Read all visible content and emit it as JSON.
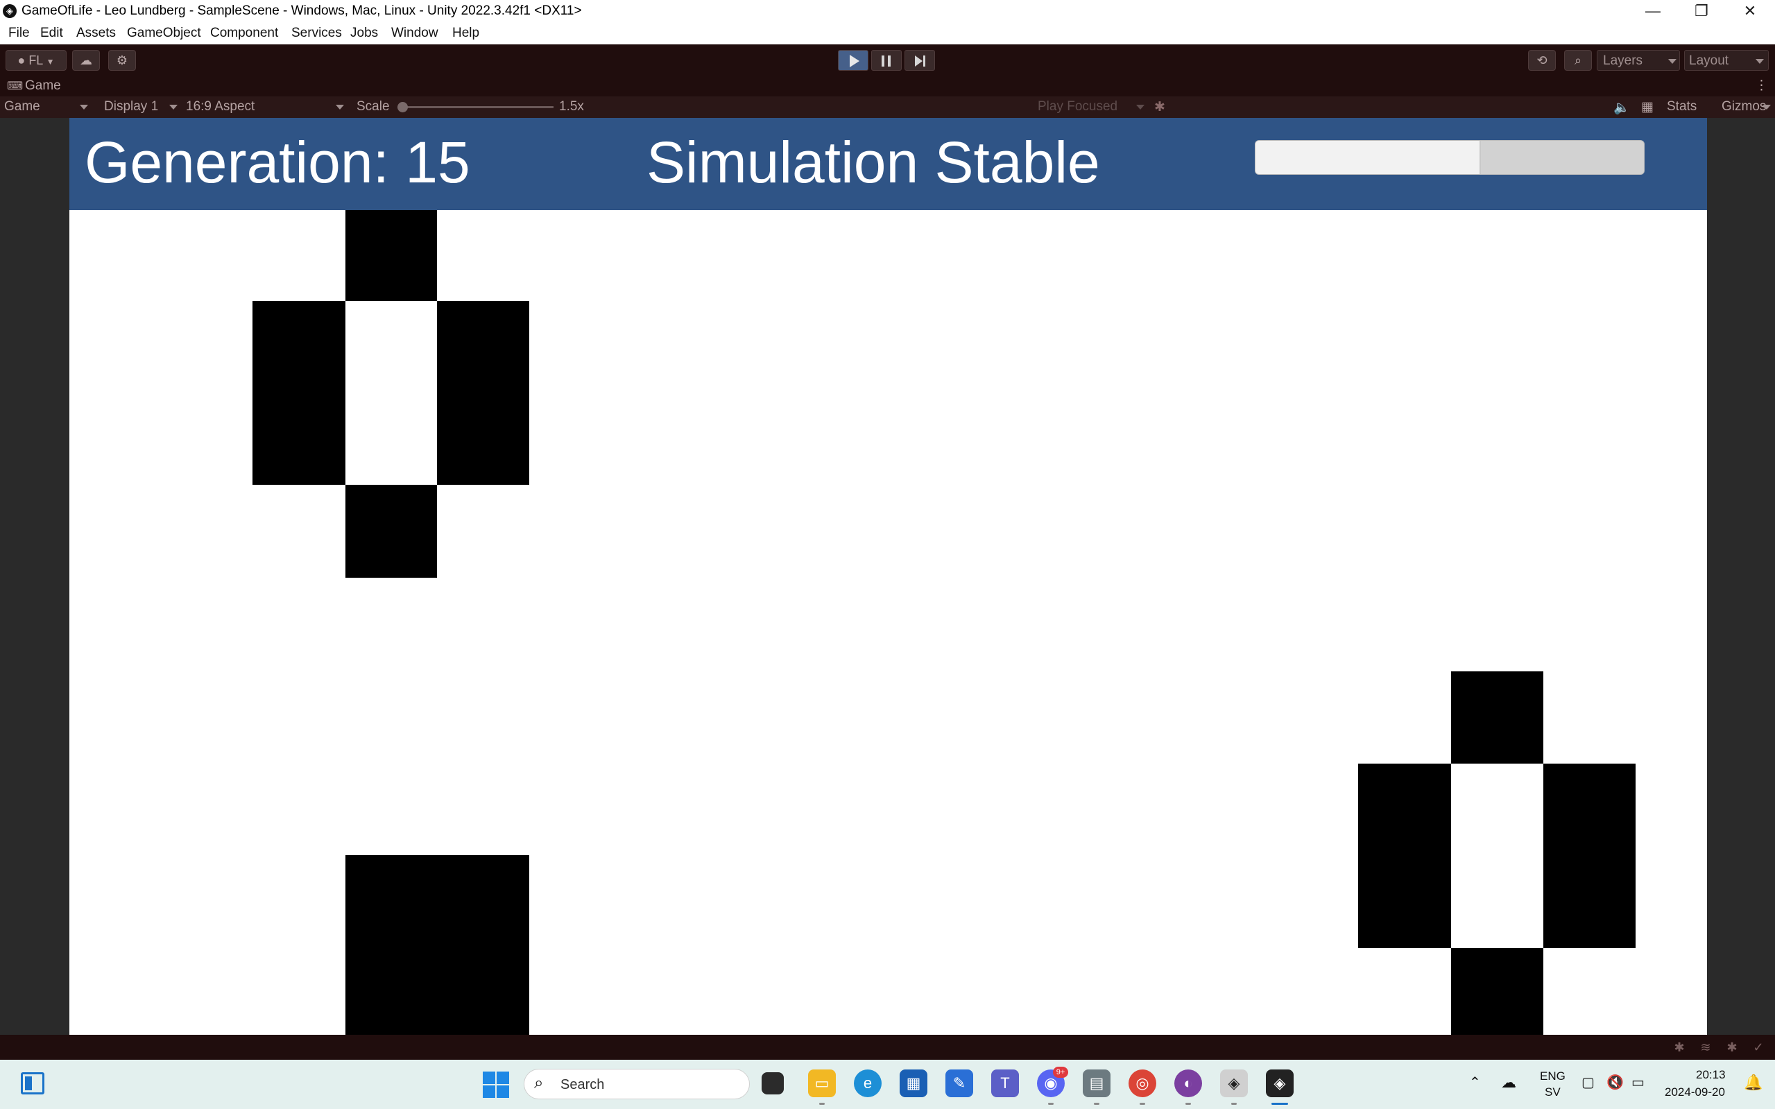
{
  "window": {
    "title": "GameOfLife - Leo Lundberg - SampleScene - Windows, Mac, Linux - Unity 2022.3.42f1 <DX11>",
    "minimize": "—",
    "maximize": "❐",
    "close": "✕"
  },
  "menu": [
    "File",
    "Edit",
    "Assets",
    "GameObject",
    "Component",
    "Services",
    "Jobs",
    "Window",
    "Help"
  ],
  "toolbar": {
    "account": "FL",
    "layers": "Layers",
    "layout": "Layout",
    "play_active": true
  },
  "game_tab": {
    "label": "Game",
    "mode": "Game",
    "display": "Display 1",
    "aspect": "16:9 Aspect",
    "scale_label": "Scale",
    "scale_value": "1.5x",
    "play_focused": "Play Focused",
    "stats": "Stats",
    "gizmos": "Gizmos"
  },
  "game": {
    "generation": "Generation: 15",
    "status": "Simulation Stable",
    "progress_fraction": 0.58
  },
  "taskbar": {
    "search_placeholder": "Search",
    "lang_top": "ENG",
    "lang_bottom": "SV",
    "time": "20:13",
    "date": "2024-09-20",
    "discord_badge": "9+"
  },
  "icon_names": {
    "unity": "unity-logo-icon",
    "cloud": "cloud-icon",
    "settings": "gear-icon",
    "history": "history-icon",
    "search": "search-icon"
  }
}
